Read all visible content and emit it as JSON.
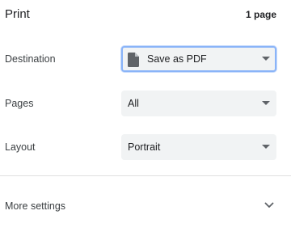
{
  "header": {
    "title": "Print",
    "page_count": "1 page"
  },
  "settings": {
    "destination": {
      "label": "Destination",
      "value": "Save as PDF",
      "icon": "file-icon"
    },
    "pages": {
      "label": "Pages",
      "value": "All"
    },
    "layout": {
      "label": "Layout",
      "value": "Portrait"
    }
  },
  "more_settings": {
    "label": "More settings",
    "icon": "chevron-down-icon"
  },
  "colors": {
    "focus_border": "#8ab4f8",
    "select_background": "#f1f3f4",
    "divider": "#e0e0e0"
  }
}
